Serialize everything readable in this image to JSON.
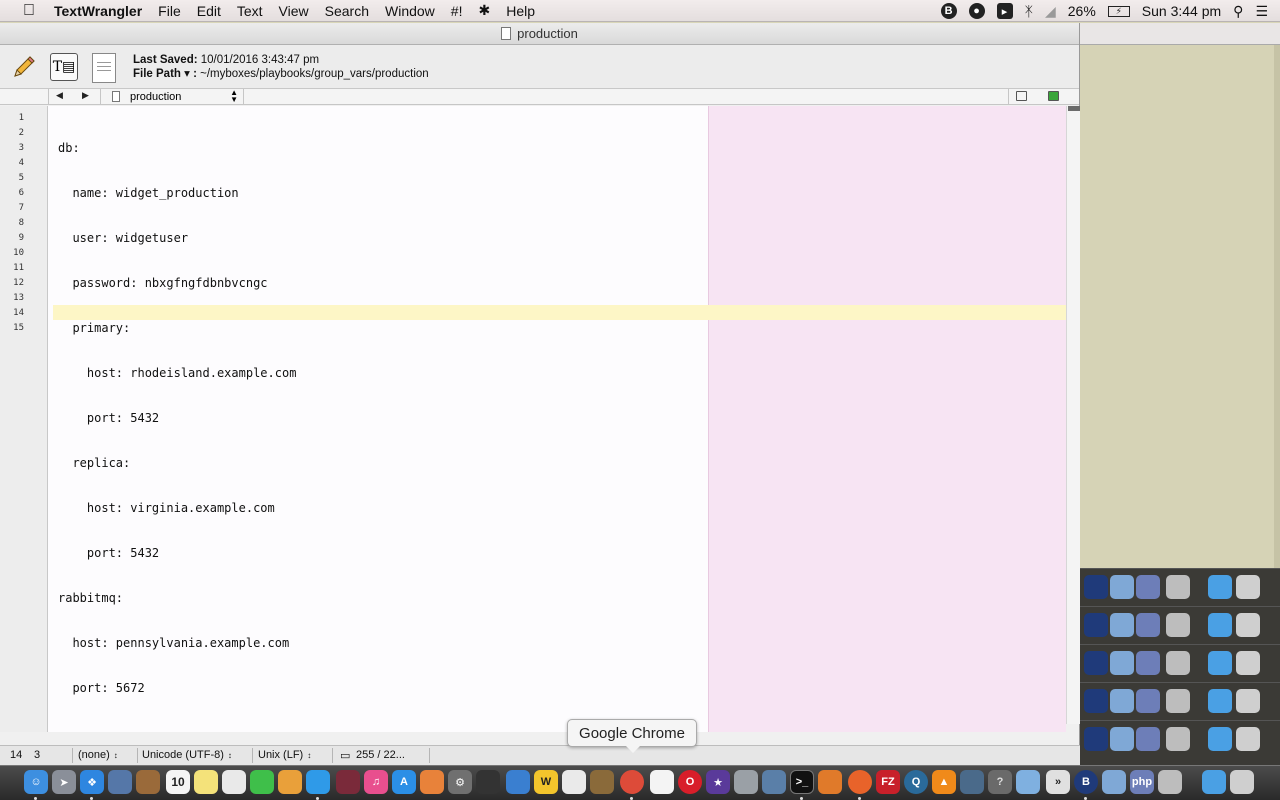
{
  "menubar": {
    "app_name": "TextWrangler",
    "menus": [
      "File",
      "Edit",
      "Text",
      "View",
      "Search",
      "Window",
      "#!",
      "Help"
    ],
    "battery": "26%",
    "clock": "Sun 3:44 pm",
    "status_icons": [
      "bbedit-icon",
      "record-icon",
      "airplay-icon",
      "bluetooth-icon",
      "wifi-icon",
      "battery-icon",
      "spotlight-icon",
      "notification-center-icon"
    ]
  },
  "window": {
    "title": "production",
    "last_saved_label": "Last Saved:",
    "last_saved_value": "10/01/2016 3:43:47 pm",
    "file_path_label": "File Path ▾ :",
    "file_path_value": "~/myboxes/playbooks/group_vars/production",
    "current_file": "production"
  },
  "editor": {
    "line_numbers": [
      "1",
      "2",
      "3",
      "4",
      "5",
      "6",
      "7",
      "8",
      "9",
      "10",
      "11",
      "12",
      "13",
      "14",
      "15"
    ],
    "lines": [
      "db:",
      "  name: widget_production",
      "  user: widgetuser",
      "  password: nbxgfngfdbnbvcngc",
      "  primary:",
      "    host: rhodeisland.example.com",
      "    port: 5432",
      "  replica:",
      "    host: virginia.example.com",
      "    port: 5432",
      "rabbitmq:",
      "  host: pennsylvania.example.com",
      "  port: 5672",
      "",
      ""
    ]
  },
  "statusbar": {
    "line": "14",
    "column": "3",
    "language": "(none)",
    "encoding": "Unicode (UTF-8)",
    "line_endings": "Unix (LF)",
    "stats": "255 / 22..."
  },
  "tooltip": "Google Chrome",
  "dock": {
    "calendar_day": "10"
  }
}
